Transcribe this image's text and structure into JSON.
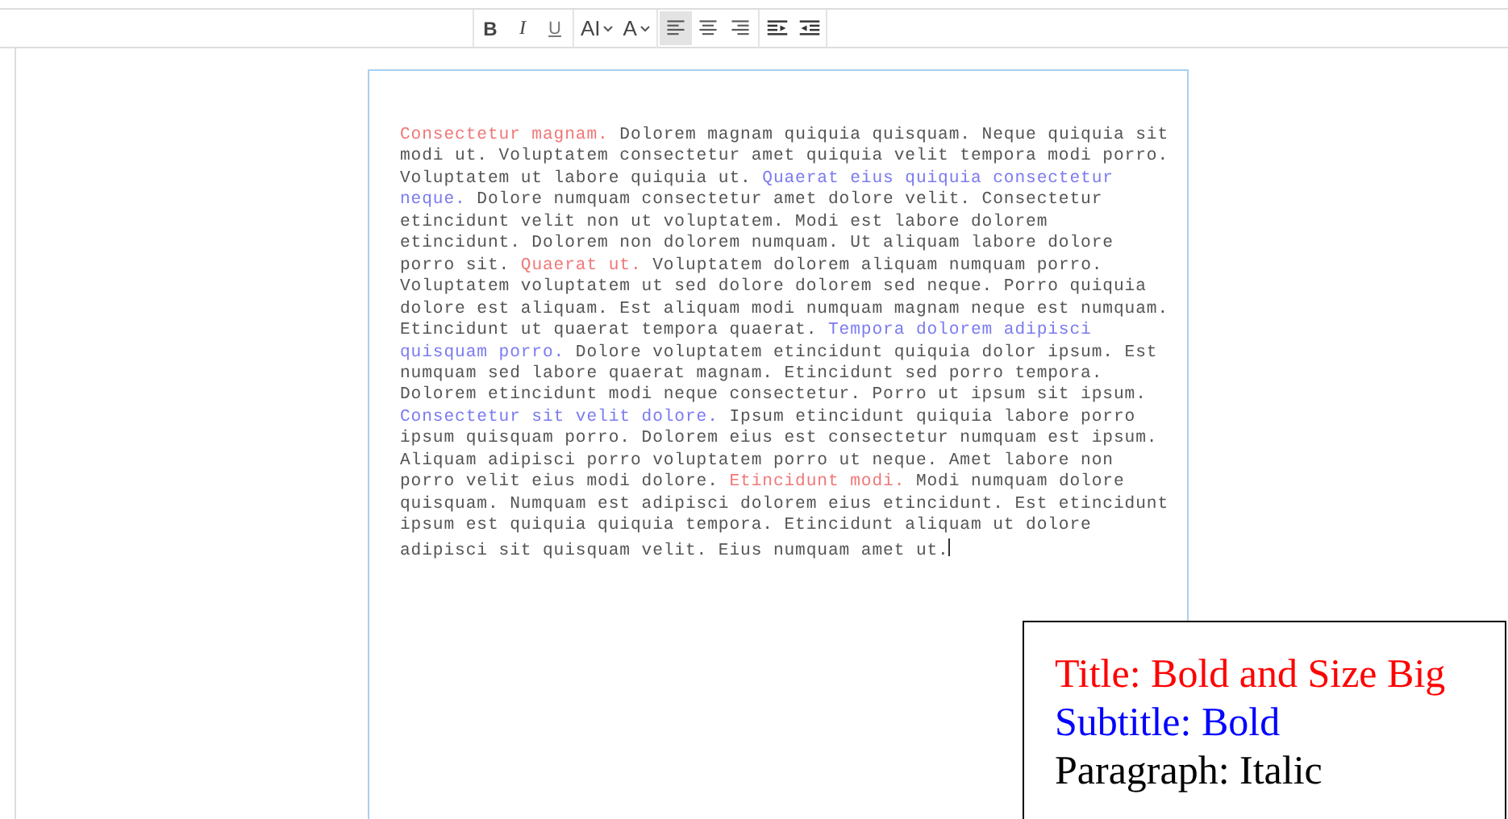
{
  "toolbar": [
    {
      "kind": "bold",
      "label": "B",
      "selected": false
    },
    {
      "kind": "italic",
      "label": "I",
      "selected": false
    },
    {
      "kind": "underline",
      "label": "U",
      "selected": false
    },
    {
      "kind": "font-size",
      "label": "AI",
      "selected": false
    },
    {
      "kind": "text-style",
      "label": "A",
      "selected": false
    },
    {
      "kind": "align-left",
      "selected": true
    },
    {
      "kind": "align-center",
      "selected": false
    },
    {
      "kind": "align-right",
      "selected": false
    },
    {
      "kind": "outdent",
      "selected": false
    },
    {
      "kind": "indent",
      "selected": false
    }
  ],
  "document": {
    "segments": [
      {
        "kind": "title",
        "text": "Consectetur magnam."
      },
      {
        "kind": "body",
        "text": " Dolorem magnam quiquia quisquam. Neque quiquia sit modi ut. Voluptatem consectetur amet quiquia velit tempora modi porro. Voluptatem ut labore quiquia ut. "
      },
      {
        "kind": "subtitle",
        "text": "Quaerat eius quiquia consectetur neque."
      },
      {
        "kind": "body",
        "text": " Dolore numquam consectetur amet dolore velit. Consectetur etincidunt velit non ut voluptatem. Modi est labore dolorem etincidunt. Dolorem non dolorem numquam. Ut aliquam labore dolore porro sit. "
      },
      {
        "kind": "title",
        "text": "Quaerat ut."
      },
      {
        "kind": "body",
        "text": " Voluptatem dolorem aliquam numquam porro. Voluptatem voluptatem ut sed dolore dolorem sed neque. Porro quiquia dolore est aliquam. Est aliquam modi numquam magnam neque est numquam. Etincidunt ut quaerat tempora quaerat. "
      },
      {
        "kind": "subtitle",
        "text": "Tempora dolorem adipisci quisquam porro."
      },
      {
        "kind": "body",
        "text": " Dolore voluptatem etincidunt quiquia dolor ipsum. Est numquam sed labore quaerat magnam. Etincidunt sed porro tempora. Dolorem etincidunt modi neque consectetur. Porro ut ipsum sit ipsum. "
      },
      {
        "kind": "subtitle",
        "text": "Consectetur sit velit dolore."
      },
      {
        "kind": "body",
        "text": " Ipsum etincidunt quiquia labore porro ipsum quisquam porro. Dolorem eius est consectetur numquam est ipsum. Aliquam adipisci porro voluptatem porro ut neque. Amet labore non porro velit eius modi dolore. "
      },
      {
        "kind": "title",
        "text": "Etincidunt modi."
      },
      {
        "kind": "body",
        "text": " Modi numquam dolore quisquam. Numquam est adipisci dolorem eius etincidunt. Est etincidunt ipsum est quiquia quiquia tempora. Etincidunt aliquam ut dolore adipisci sit quisquam velit. Eius numquam amet ut."
      }
    ]
  },
  "legend": [
    {
      "kind": "title",
      "text": "Title: Bold and Size Big"
    },
    {
      "kind": "subtitle",
      "text": "Subtitle: Bold"
    },
    {
      "kind": "paragraph",
      "text": "Paragraph: Italic"
    }
  ]
}
